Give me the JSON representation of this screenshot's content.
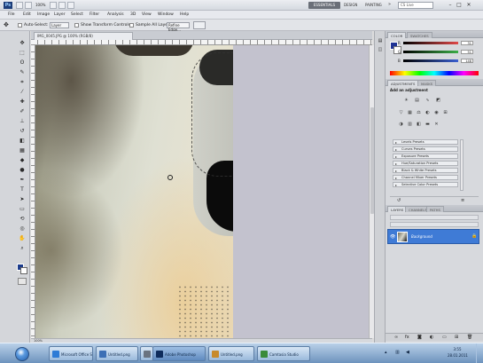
{
  "app": {
    "logo": "Ps",
    "zoom": "100%",
    "workspace": "ESSENTIALS",
    "search_placeholder": "CS Live",
    "window_controls": [
      "–",
      "□",
      "✕"
    ]
  },
  "menu": [
    "File",
    "Edit",
    "Image",
    "Layer",
    "Select",
    "Filter",
    "Analysis",
    "3D",
    "View",
    "Window",
    "Help"
  ],
  "options": {
    "auto_select_label": "Auto-Select:",
    "auto_select_value": "Layer",
    "show_transform_label": "Show Transform Controls",
    "sample_all_label": "Sample All Layers",
    "refine_edge_label": "Refine Edge..."
  },
  "document": {
    "tab_title": "IMG_0045.JPG @ 100% (RGB/8)",
    "status": "100%"
  },
  "tools": [
    {
      "name": "move-tool-icon",
      "glyph": "✥"
    },
    {
      "name": "marquee-tool-icon",
      "glyph": "⬚"
    },
    {
      "name": "lasso-tool-icon",
      "glyph": "ʘ"
    },
    {
      "name": "quick-select-tool-icon",
      "glyph": "✎"
    },
    {
      "name": "crop-tool-icon",
      "glyph": "⌗"
    },
    {
      "name": "eyedropper-tool-icon",
      "glyph": "⁄"
    },
    {
      "name": "healing-tool-icon",
      "glyph": "✚"
    },
    {
      "name": "brush-tool-icon",
      "glyph": "✐"
    },
    {
      "name": "stamp-tool-icon",
      "glyph": "⊥"
    },
    {
      "name": "history-brush-icon",
      "glyph": "↺"
    },
    {
      "name": "eraser-tool-icon",
      "glyph": "◧"
    },
    {
      "name": "gradient-tool-icon",
      "glyph": "▦"
    },
    {
      "name": "blur-tool-icon",
      "glyph": "◆"
    },
    {
      "name": "dodge-tool-icon",
      "glyph": "●"
    },
    {
      "name": "pen-tool-icon",
      "glyph": "✒"
    },
    {
      "name": "type-tool-icon",
      "glyph": "T"
    },
    {
      "name": "path-select-icon",
      "glyph": "➤"
    },
    {
      "name": "shape-tool-icon",
      "glyph": "▭"
    },
    {
      "name": "3d-rotate-icon",
      "glyph": "⟲"
    },
    {
      "name": "3d-orbit-icon",
      "glyph": "◎"
    },
    {
      "name": "hand-tool-icon",
      "glyph": "✋"
    },
    {
      "name": "zoom-tool-icon",
      "glyph": "⌕"
    }
  ],
  "color_panel": {
    "tabs": [
      "COLOR",
      "SWATCHES"
    ],
    "channels": [
      {
        "label": "R",
        "value": "31",
        "color": "#e04848"
      },
      {
        "label": "G",
        "value": "51",
        "color": "#3cae48"
      },
      {
        "label": "B",
        "value": "148",
        "color": "#3a5fd0"
      }
    ],
    "foreground": "#1f3394"
  },
  "adjustments_panel": {
    "tabs": [
      "ADJUSTMENTS",
      "MASKS"
    ],
    "heading": "Add an adjustment",
    "presets": [
      "Levels Presets",
      "Curves Presets",
      "Exposure Presets",
      "Hue/Saturation Presets",
      "Black & White Presets",
      "Channel Mixer Presets",
      "Selective Color Presets"
    ]
  },
  "layers_panel": {
    "tabs": [
      "LAYERS",
      "CHANNELS",
      "PATHS"
    ],
    "layer_name": "Background"
  },
  "taskbar": {
    "tasks": [
      {
        "label": "Microsoft Office Sig...",
        "color": "#2d7bd6"
      },
      {
        "label": "Untitled.png",
        "color": "#3c6fb5"
      },
      {
        "label": "",
        "color": "#6a7380"
      },
      {
        "label": "Adobe Photoshop",
        "color": "#0e2c5c"
      },
      {
        "label": "Untitled.png",
        "color": "#c78a2b"
      },
      {
        "label": "Camtasia Studio",
        "color": "#3a8b3a"
      }
    ],
    "time": "3:55",
    "date": "28.01.2011"
  }
}
